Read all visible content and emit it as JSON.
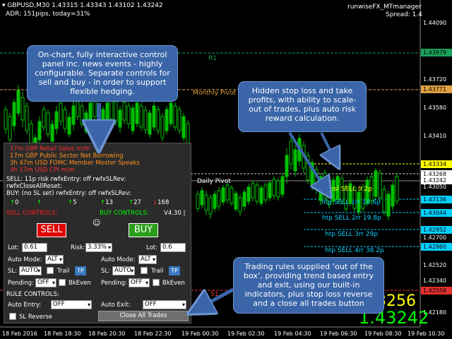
{
  "header": {
    "symbol_line": "GBPUSD,M30  1.43315 1.43343 1.43102 1.43242",
    "adr_line": "ADR: 151pips, today=31%",
    "indicator_name": "runwiseFX_MTmanager",
    "spread": "Spread: 1.4"
  },
  "price_axis": {
    "plain": [
      "1.44090",
      "1.43720",
      "1.43580",
      "1.43410",
      "1.43050",
      "1.42700",
      "1.42520",
      "1.42340",
      "1.42180"
    ],
    "tags": [
      {
        "text": "1.43979",
        "color": "#1aa05a",
        "fg": "#000000"
      },
      {
        "text": "1.43771",
        "color": "#e0a040",
        "fg": "#000000"
      },
      {
        "text": "1.43334",
        "color": "#ffff00",
        "fg": "#000000"
      },
      {
        "text": "1.43268",
        "color": "#ffffff",
        "fg": "#000000"
      },
      {
        "text": "1.43242",
        "color": "#ffffff",
        "fg": "#000000"
      },
      {
        "text": "1.43136",
        "color": "#00d0ff",
        "fg": "#000000"
      },
      {
        "text": "1.43044",
        "color": "#00d0ff",
        "fg": "#000000"
      },
      {
        "text": "1.42952",
        "color": "#00d0ff",
        "fg": "#000000"
      },
      {
        "text": "1.42860",
        "color": "#00d0ff",
        "fg": "#000000"
      },
      {
        "text": "1.42558",
        "color": "#e03030",
        "fg": "#000000"
      }
    ]
  },
  "time_axis": [
    "18 Feb 2016",
    "18 Feb 18:30",
    "18 Feb 20:30",
    "18 Feb 22:30",
    "19 Feb 00:30",
    "19 Feb 02:30",
    "19 Feb 04:30",
    "19 Feb 06:30",
    "19 Feb 08:30",
    "19 Feb 10:30"
  ],
  "pivots": {
    "r1": "R1",
    "monthly": "Monthly Pivot",
    "daily": "Daily Pivot",
    "s1": "S1"
  },
  "trade_levels": {
    "hsl": "hsl SELL 9.2p",
    "tp1": "htp SELL 1rr 10.6p",
    "tp2": "htp SELL 2rr 19.8p",
    "tp3": "htp SELL 3rr 29p",
    "tp4": "htp SELL 4rr 38.2p"
  },
  "callouts": {
    "panel": "On-chart, fully interactive control panel inc. news events - highly configurable. Separate controls for sell and buy - in order to support flexible hedging.",
    "stops": "Hidden stop loss and take profits, with ability to scale-out of trades, plus auto risk reward calculation.",
    "rules": "Trading rules supplied ‘out of the box’, providing trend based entry and exit, using our built-in indicators, plus stop loss reverse and a close all trades button"
  },
  "big_prices": {
    "bid": "1.43256",
    "ask": "1.43242"
  },
  "panel": {
    "news": [
      {
        "text": "17m GBP Retail Sales m/m",
        "color": "#ff3030"
      },
      {
        "text": "17m GBP Public Sector Net Borrowing",
        "color": "#ff9020"
      },
      {
        "text": "3h 47m USD FOMC Member Mester Speaks",
        "color": "#ff9020"
      },
      {
        "text": "4h 17m USD CPI m/m",
        "color": "#ff3030"
      }
    ],
    "status_lines": [
      "SELL: 11p risk  rwfxEntry: off rwfxSLRev:",
      "rwfxCloseAllReset:",
      "BUY: (no SL set)  rwfxEntry: off rwfxSLRev:"
    ],
    "arrows": [
      {
        "glyph": "↑",
        "value": "0",
        "color": "#00ff00"
      },
      {
        "glyph": "↑",
        "value": "",
        "color": "#00ff00"
      },
      {
        "glyph": "↑",
        "value": "5",
        "color": "#00ff00"
      },
      {
        "glyph": "↑",
        "value": "13",
        "color": "#00ff00"
      },
      {
        "glyph": "↑",
        "value": "27",
        "color": "#00ff00"
      },
      {
        "glyph": "↓",
        "value": "168",
        "color": "#ff2020"
      }
    ],
    "sell_controls": "SELL CONTROLS:",
    "buy_controls": "BUY CONTROLS:",
    "version": "V4.30 |",
    "smiley": "☺",
    "sell_button": "SELL",
    "buy_button": "BUY",
    "lot_label": "Lot:",
    "sell_lot": "0.61",
    "risk_label": "Risk:",
    "risk_value": "3.33%",
    "buy_lot": "0.6",
    "auto_mode_label": "Auto Mode:",
    "sell_auto_mode": "ALT",
    "buy_auto_mode": "ALT",
    "sl_label": "SL:",
    "sell_sl": "AUTO",
    "buy_sl": "AUTO",
    "trail_label": "Trail",
    "tp_label": "TP",
    "pending_label": "Pending:",
    "sell_pending": "OFF",
    "buy_pending": "OFF",
    "bkeven_label": "BkEven",
    "rule_controls": "RULE CONTROLS:",
    "auto_entry_label": "Auto Entry:",
    "auto_entry": "OFF",
    "auto_exit_label": "Auto Exit:",
    "auto_exit": "OFF",
    "sl_reverse": "SL Reverse",
    "close_all": "Close All Trades"
  }
}
